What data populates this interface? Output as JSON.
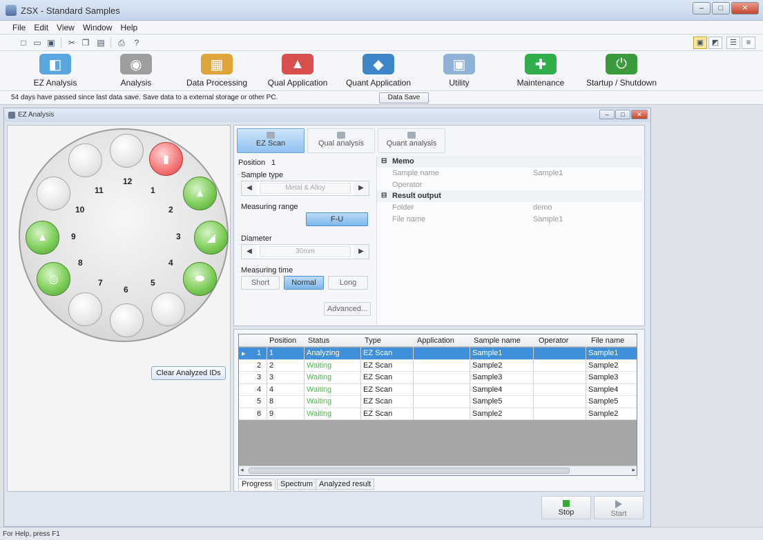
{
  "window": {
    "title": "ZSX - Standard Samples",
    "min": "–",
    "max": "□",
    "close": "✕"
  },
  "menu": [
    "File",
    "Edit",
    "View",
    "Window",
    "Help"
  ],
  "launcher": [
    {
      "label": "EZ Analysis",
      "icon": "ez-analysis-icon",
      "color": "#5aa6e0",
      "glyph": "◧"
    },
    {
      "label": "Analysis",
      "icon": "analysis-icon",
      "color": "#9e9e9e",
      "glyph": "◉"
    },
    {
      "label": "Data Processing",
      "icon": "data-processing-icon",
      "color": "#e0a53a",
      "glyph": "▦"
    },
    {
      "label": "Qual Application",
      "icon": "qual-application-icon",
      "color": "#d94e4e",
      "glyph": "▲"
    },
    {
      "label": "Quant Application",
      "icon": "quant-application-icon",
      "color": "#3f86c9",
      "glyph": "◆"
    },
    {
      "label": "Utility",
      "icon": "utility-icon",
      "color": "#8fb2d6",
      "glyph": "▣"
    },
    {
      "label": "Maintenance",
      "icon": "maintenance-icon",
      "color": "#2fae4b",
      "glyph": "✚"
    },
    {
      "label": "Startup / Shutdown",
      "icon": "power-icon",
      "color": "#3b9a3b",
      "glyph": "⏻"
    }
  ],
  "notice": {
    "text": "54 days have passed since last data save. Save data to a external storage or other PC.",
    "button": "Data Save"
  },
  "child": {
    "title": "EZ Analysis"
  },
  "wheel": {
    "numbers": [
      "12",
      "1",
      "2",
      "3",
      "4",
      "5",
      "6",
      "7",
      "8",
      "9",
      "10",
      "11"
    ]
  },
  "clear_button": "Clear Analyzed IDs",
  "modes": [
    "EZ Scan",
    "Qual analysis",
    "Quant analysis"
  ],
  "setup": {
    "position_label": "Position",
    "position_value": "1",
    "sample_type_label": "Sample type",
    "sample_type_value": "Metal & Alloy",
    "measuring_range_label": "Measuring range",
    "measuring_range_value": "F-U",
    "diameter_label": "Diameter",
    "diameter_value": "30mm",
    "measuring_time_label": "Measuring time",
    "time_options": [
      "Short",
      "Normal",
      "Long"
    ],
    "advanced": "Advanced..."
  },
  "props": {
    "memo": "Memo",
    "sample_name_label": "Sample name",
    "sample_name": "Sample1",
    "operator_label": "Operator",
    "result_output": "Result output",
    "folder_label": "Folder",
    "folder": "demo",
    "file_name_label": "File name",
    "file_name": "Sample1"
  },
  "table": {
    "headers": [
      "Position",
      "Status",
      "Type",
      "Application",
      "Sample name",
      "Operator",
      "File name"
    ],
    "rows": [
      {
        "idx": "1",
        "position": "1",
        "status": "Analyzing",
        "type": "EZ Scan",
        "sample": "Sample1",
        "file": "Sample1"
      },
      {
        "idx": "2",
        "position": "2",
        "status": "Waiting",
        "type": "EZ Scan",
        "sample": "Sample2",
        "file": "Sample2"
      },
      {
        "idx": "3",
        "position": "3",
        "status": "Waiting",
        "type": "EZ Scan",
        "sample": "Sample3",
        "file": "Sample3"
      },
      {
        "idx": "4",
        "position": "4",
        "status": "Waiting",
        "type": "EZ Scan",
        "sample": "Sample4",
        "file": "Sample4"
      },
      {
        "idx": "5",
        "position": "8",
        "status": "Waiting",
        "type": "EZ Scan",
        "sample": "Sample5",
        "file": "Sample5"
      },
      {
        "idx": "6",
        "position": "9",
        "status": "Waiting",
        "type": "EZ Scan",
        "sample": "Sample2",
        "file": "Sample2"
      }
    ]
  },
  "bottom_tabs": [
    "Progress",
    "Spectrum",
    "Analyzed result"
  ],
  "actions": {
    "stop": "Stop",
    "start": "Start"
  },
  "status": "For Help, press F1",
  "colors": {
    "waiting": "#4fb84f",
    "selected": "#3f8fdb"
  }
}
